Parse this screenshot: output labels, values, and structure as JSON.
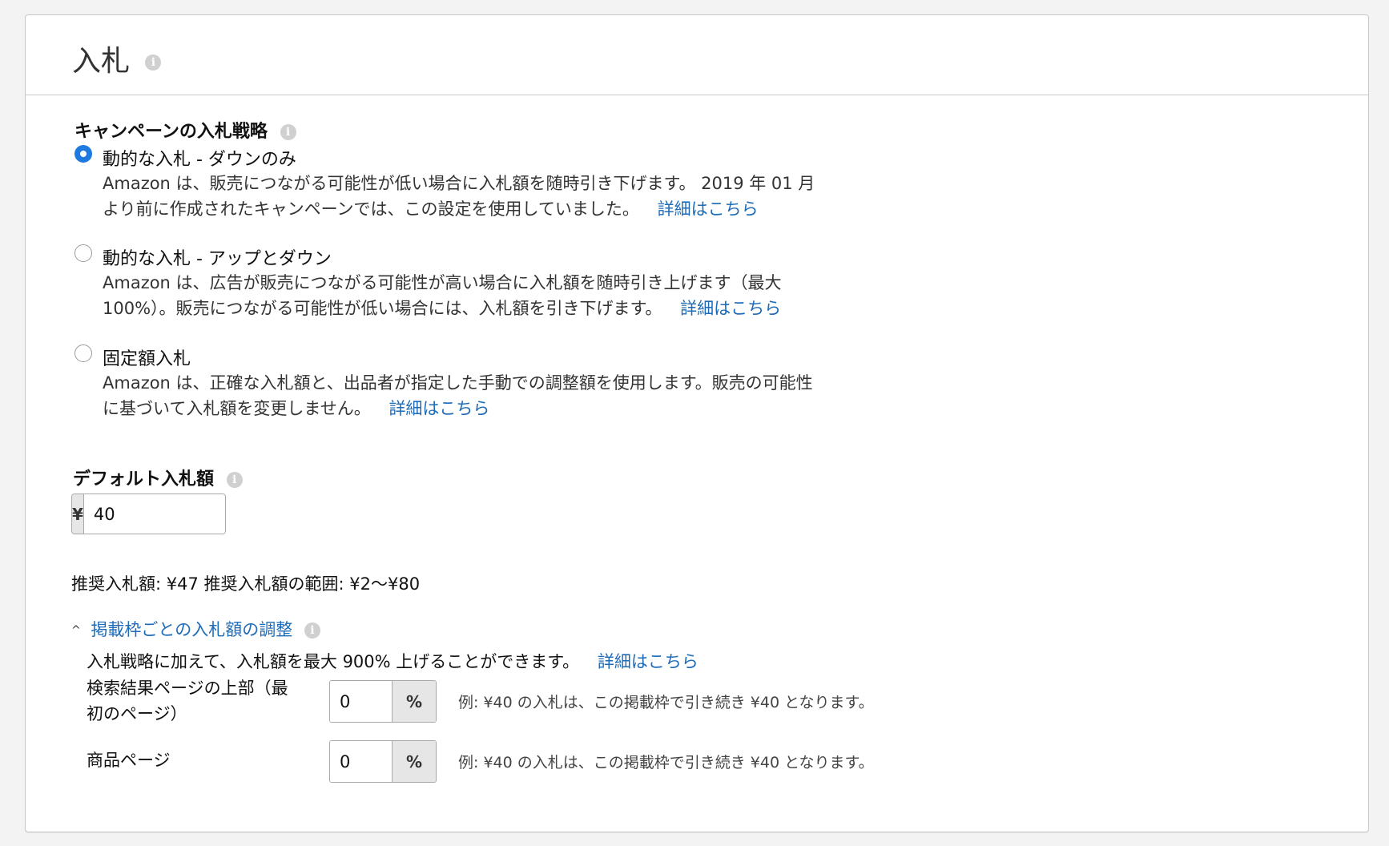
{
  "header": {
    "title": "入札"
  },
  "strategy": {
    "label": "キャンペーンの入札戦略",
    "options": [
      {
        "label": "動的な入札 - ダウンのみ",
        "selected": true,
        "desc_line1": "Amazon は、販売につながる可能性が低い場合に入札額を随時引き下げます。 2019 年 01 月",
        "desc_line2": "より前に作成されたキャンペーンでは、この設定を使用していました。",
        "link": "詳細はこちら"
      },
      {
        "label": "動的な入札 - アップとダウン",
        "selected": false,
        "desc_line1": "Amazon は、広告が販売につながる可能性が高い場合に入札額を随時引き上げます（最大",
        "desc_line2": "100%）。販売につながる可能性が低い場合には、入札額を引き下げます。",
        "link": "詳細はこちら"
      },
      {
        "label": "固定額入札",
        "selected": false,
        "desc_line1": "Amazon は、正確な入札額と、出品者が指定した手動での調整額を使用します。販売の可能性",
        "desc_line2": "に基づいて入札額を変更しません。",
        "link": "詳細はこちら"
      }
    ]
  },
  "default_bid": {
    "label": "デフォルト入札額",
    "currency": "¥",
    "value": "40"
  },
  "suggested": "推奨入札額: ¥47 推奨入札額の範囲: ¥2〜¥80",
  "adjustments": {
    "toggle_label": "掲載枠ごとの入札額の調整",
    "intro": "入札戦略に加えて、入札額を最大 900% 上げることができます。",
    "intro_link": "詳細はこちら",
    "rows": [
      {
        "label_line1": "検索結果ページの上部（最",
        "label_line2": "初のページ）",
        "value": "0",
        "suffix": "%",
        "example": "例: ¥40 の入札は、この掲載枠で引き続き ¥40 となります。"
      },
      {
        "label_line1": "商品ページ",
        "label_line2": "",
        "value": "0",
        "suffix": "%",
        "example": "例: ¥40 の入札は、この掲載枠で引き続き ¥40 となります。"
      }
    ]
  },
  "colors": {
    "accent": "#1f7ae0",
    "link": "#1e6bb8"
  }
}
